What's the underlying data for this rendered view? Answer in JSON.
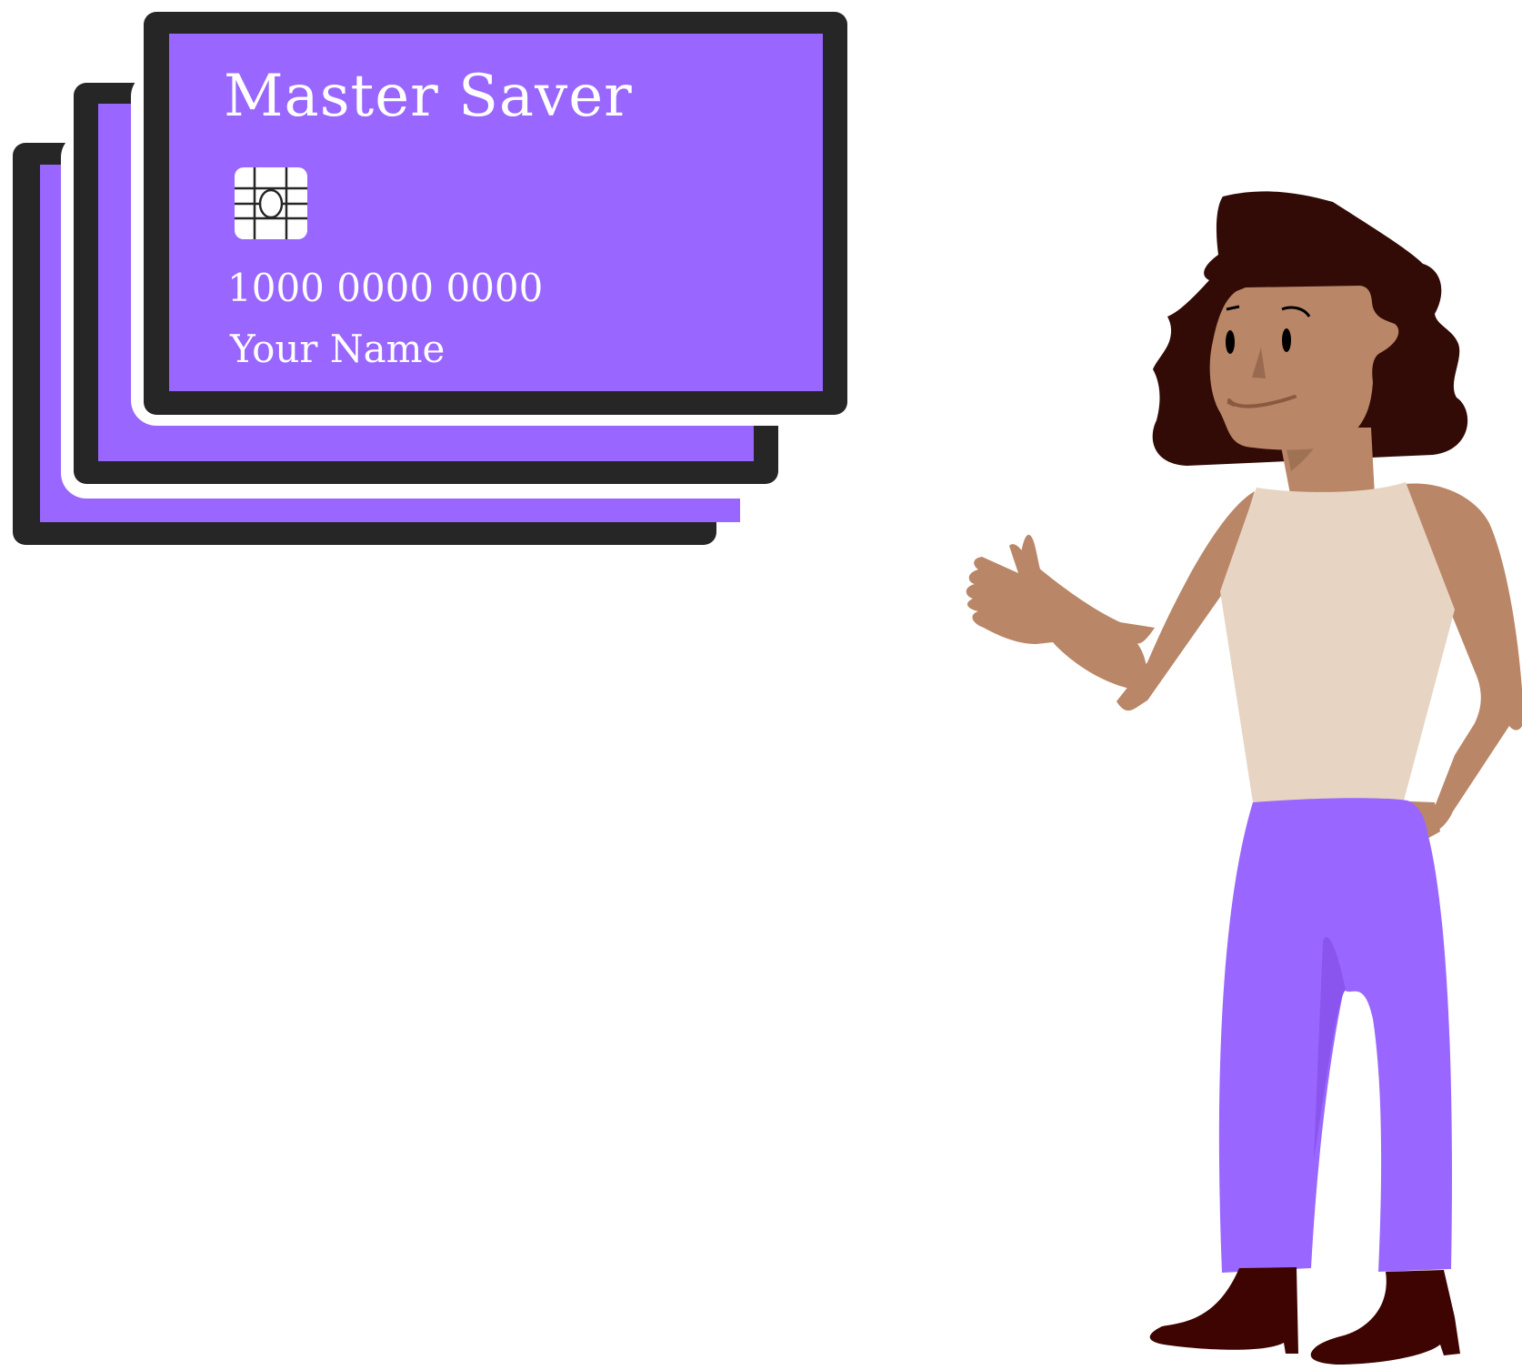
{
  "card": {
    "title": "Master Saver",
    "number": "1000 0000 0000",
    "name": "Your Name"
  },
  "colors": {
    "card_purple": "#9966ff",
    "card_border": "#262626",
    "skin": "#b98667",
    "hair": "#320a06",
    "top": "#e8d4c2",
    "pants": "#9966ff",
    "boots": "#3d0402"
  },
  "icons": {
    "chip": "card-chip-icon"
  }
}
